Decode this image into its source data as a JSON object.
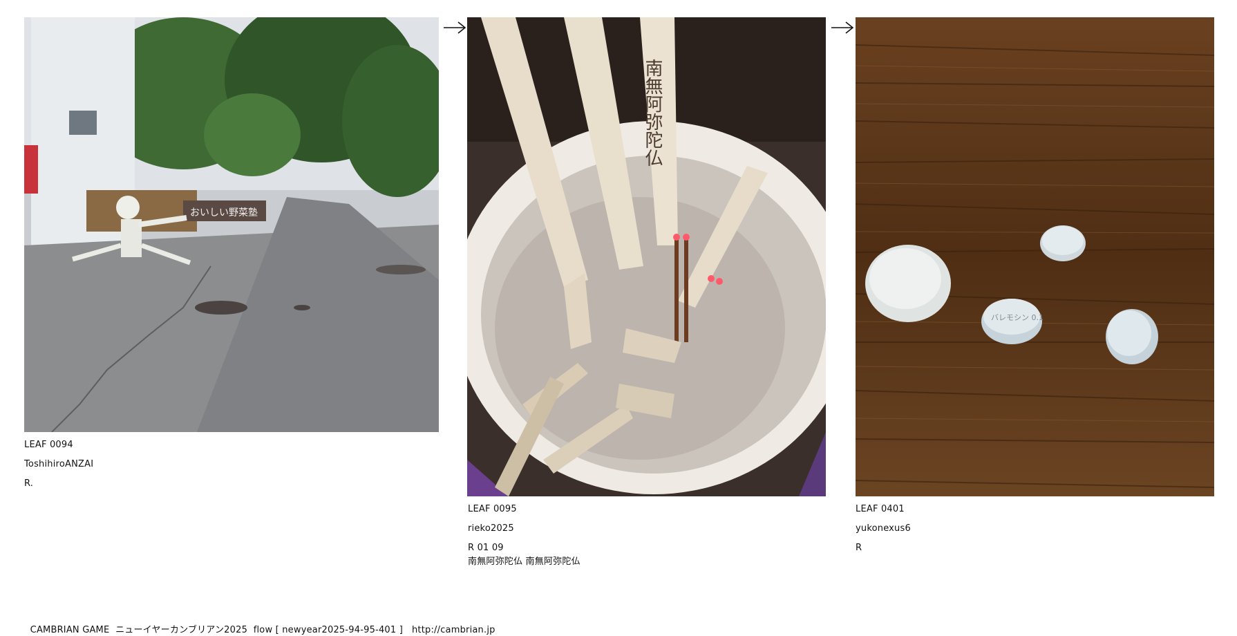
{
  "leaves": [
    {
      "leaf": "LEAF 0094",
      "author": "ToshihiroANZAI",
      "rating": "R.",
      "note": "",
      "photo_sign": "おいしい野菜塾"
    },
    {
      "leaf": "LEAF 0095",
      "author": "rieko2025",
      "rating": "R 01 09",
      "note": "南無阿弥陀仏 南無阿弥陀仏",
      "photo_sign": "南無阿弥陀仏"
    },
    {
      "leaf": "LEAF 0401",
      "author": "yukonexus6",
      "rating": "R",
      "note": "",
      "photo_sign": "バレモシン 0.1"
    }
  ],
  "arrows": [
    "→",
    "→"
  ],
  "footer": {
    "game": "CAMBRIAN GAME",
    "title": "ニューイヤーカンブリアン2025",
    "flow": "flow [ newyear2025-94-95-401 ]",
    "url": "http://cambrian.jp"
  }
}
